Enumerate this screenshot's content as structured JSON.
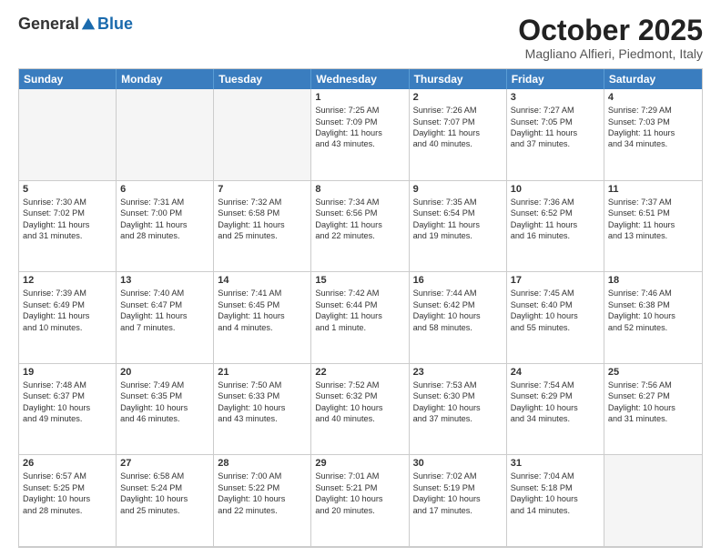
{
  "header": {
    "logo_general": "General",
    "logo_blue": "Blue",
    "month_title": "October 2025",
    "location": "Magliano Alfieri, Piedmont, Italy"
  },
  "day_headers": [
    "Sunday",
    "Monday",
    "Tuesday",
    "Wednesday",
    "Thursday",
    "Friday",
    "Saturday"
  ],
  "weeks": [
    [
      {
        "day": "",
        "content": "",
        "empty": true
      },
      {
        "day": "",
        "content": "",
        "empty": true
      },
      {
        "day": "",
        "content": "",
        "empty": true
      },
      {
        "day": "1",
        "content": "Sunrise: 7:25 AM\nSunset: 7:09 PM\nDaylight: 11 hours\nand 43 minutes."
      },
      {
        "day": "2",
        "content": "Sunrise: 7:26 AM\nSunset: 7:07 PM\nDaylight: 11 hours\nand 40 minutes."
      },
      {
        "day": "3",
        "content": "Sunrise: 7:27 AM\nSunset: 7:05 PM\nDaylight: 11 hours\nand 37 minutes."
      },
      {
        "day": "4",
        "content": "Sunrise: 7:29 AM\nSunset: 7:03 PM\nDaylight: 11 hours\nand 34 minutes."
      }
    ],
    [
      {
        "day": "5",
        "content": "Sunrise: 7:30 AM\nSunset: 7:02 PM\nDaylight: 11 hours\nand 31 minutes."
      },
      {
        "day": "6",
        "content": "Sunrise: 7:31 AM\nSunset: 7:00 PM\nDaylight: 11 hours\nand 28 minutes."
      },
      {
        "day": "7",
        "content": "Sunrise: 7:32 AM\nSunset: 6:58 PM\nDaylight: 11 hours\nand 25 minutes."
      },
      {
        "day": "8",
        "content": "Sunrise: 7:34 AM\nSunset: 6:56 PM\nDaylight: 11 hours\nand 22 minutes."
      },
      {
        "day": "9",
        "content": "Sunrise: 7:35 AM\nSunset: 6:54 PM\nDaylight: 11 hours\nand 19 minutes."
      },
      {
        "day": "10",
        "content": "Sunrise: 7:36 AM\nSunset: 6:52 PM\nDaylight: 11 hours\nand 16 minutes."
      },
      {
        "day": "11",
        "content": "Sunrise: 7:37 AM\nSunset: 6:51 PM\nDaylight: 11 hours\nand 13 minutes."
      }
    ],
    [
      {
        "day": "12",
        "content": "Sunrise: 7:39 AM\nSunset: 6:49 PM\nDaylight: 11 hours\nand 10 minutes."
      },
      {
        "day": "13",
        "content": "Sunrise: 7:40 AM\nSunset: 6:47 PM\nDaylight: 11 hours\nand 7 minutes."
      },
      {
        "day": "14",
        "content": "Sunrise: 7:41 AM\nSunset: 6:45 PM\nDaylight: 11 hours\nand 4 minutes."
      },
      {
        "day": "15",
        "content": "Sunrise: 7:42 AM\nSunset: 6:44 PM\nDaylight: 11 hours\nand 1 minute."
      },
      {
        "day": "16",
        "content": "Sunrise: 7:44 AM\nSunset: 6:42 PM\nDaylight: 10 hours\nand 58 minutes."
      },
      {
        "day": "17",
        "content": "Sunrise: 7:45 AM\nSunset: 6:40 PM\nDaylight: 10 hours\nand 55 minutes."
      },
      {
        "day": "18",
        "content": "Sunrise: 7:46 AM\nSunset: 6:38 PM\nDaylight: 10 hours\nand 52 minutes."
      }
    ],
    [
      {
        "day": "19",
        "content": "Sunrise: 7:48 AM\nSunset: 6:37 PM\nDaylight: 10 hours\nand 49 minutes."
      },
      {
        "day": "20",
        "content": "Sunrise: 7:49 AM\nSunset: 6:35 PM\nDaylight: 10 hours\nand 46 minutes."
      },
      {
        "day": "21",
        "content": "Sunrise: 7:50 AM\nSunset: 6:33 PM\nDaylight: 10 hours\nand 43 minutes."
      },
      {
        "day": "22",
        "content": "Sunrise: 7:52 AM\nSunset: 6:32 PM\nDaylight: 10 hours\nand 40 minutes."
      },
      {
        "day": "23",
        "content": "Sunrise: 7:53 AM\nSunset: 6:30 PM\nDaylight: 10 hours\nand 37 minutes."
      },
      {
        "day": "24",
        "content": "Sunrise: 7:54 AM\nSunset: 6:29 PM\nDaylight: 10 hours\nand 34 minutes."
      },
      {
        "day": "25",
        "content": "Sunrise: 7:56 AM\nSunset: 6:27 PM\nDaylight: 10 hours\nand 31 minutes."
      }
    ],
    [
      {
        "day": "26",
        "content": "Sunrise: 6:57 AM\nSunset: 5:25 PM\nDaylight: 10 hours\nand 28 minutes."
      },
      {
        "day": "27",
        "content": "Sunrise: 6:58 AM\nSunset: 5:24 PM\nDaylight: 10 hours\nand 25 minutes."
      },
      {
        "day": "28",
        "content": "Sunrise: 7:00 AM\nSunset: 5:22 PM\nDaylight: 10 hours\nand 22 minutes."
      },
      {
        "day": "29",
        "content": "Sunrise: 7:01 AM\nSunset: 5:21 PM\nDaylight: 10 hours\nand 20 minutes."
      },
      {
        "day": "30",
        "content": "Sunrise: 7:02 AM\nSunset: 5:19 PM\nDaylight: 10 hours\nand 17 minutes."
      },
      {
        "day": "31",
        "content": "Sunrise: 7:04 AM\nSunset: 5:18 PM\nDaylight: 10 hours\nand 14 minutes."
      },
      {
        "day": "",
        "content": "",
        "empty": true
      }
    ]
  ]
}
